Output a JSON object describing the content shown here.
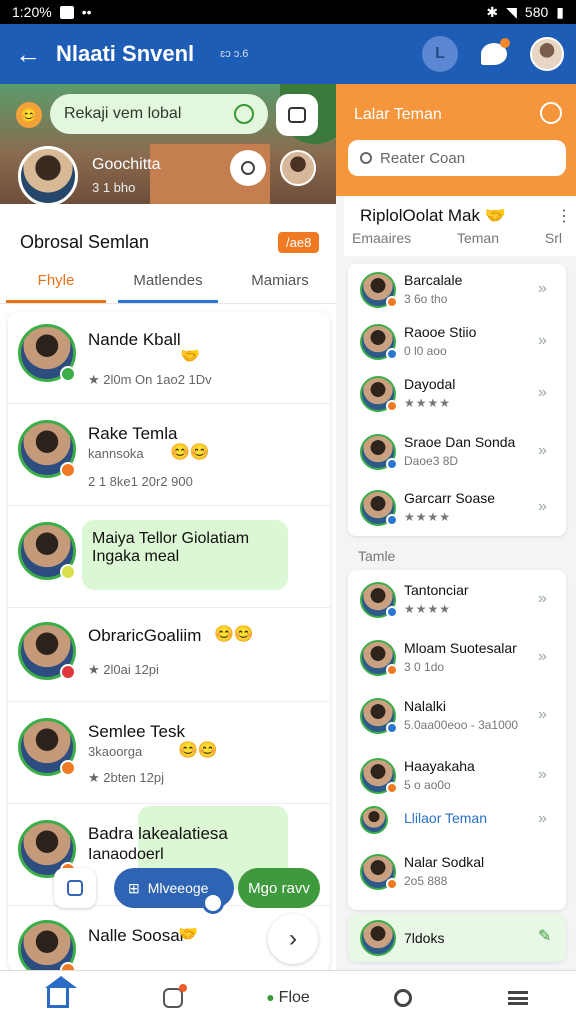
{
  "status_bar": {
    "time": "1:20%",
    "battery": "580"
  },
  "app_bar": {
    "title": "Nlaati Snvenl",
    "subtitle": "ɛɔ ɔ.6",
    "circle_label": "L"
  },
  "hero": {
    "search_text": "Rekaji vem lobal",
    "name": "Goochitta",
    "meta": "3 1 bho"
  },
  "left": {
    "section_title": "Obrosal Semlan",
    "badge": "/ae8",
    "tabs": [
      "Fhyle",
      "Matlendes",
      "Mamiars"
    ]
  },
  "conversations": [
    {
      "name": "Nande Kball",
      "meta": "★ 2l0m On 1ao2 1Dv"
    },
    {
      "name": "Rake Temla",
      "sub": "kannsoka",
      "meta": "2 1 8ke1 20r2 900"
    },
    {
      "bubble_line1": "Maiya Tellor Giolatiam",
      "bubble_line2": "Ingaka meal"
    },
    {
      "name": "ObraricGoaliim",
      "meta": "★ 2l0ai 12pi"
    },
    {
      "name": "Semlee Tesk",
      "sub": "3kaoorga",
      "meta": "★ 2bten 12pj"
    },
    {
      "bubble_line1": "Badra lakealatiesa",
      "bubble_line2": "Ianaodoerl"
    },
    {
      "name": "Nalle Soosal"
    }
  ],
  "floating": {
    "messages_label": "Mlveeoge",
    "new_label": "Mgo ravv"
  },
  "right": {
    "title": "Lalar Teman",
    "search_placeholder": "Reater Coan",
    "card_title": "RiplolOolat Mak",
    "tabs": [
      "Emaaires",
      "Teman",
      "Srl"
    ],
    "top_rows": [
      {
        "name": "Barcalale",
        "meta": "3 6o tho"
      },
      {
        "name": "Raooe Stiio",
        "meta": "0 l0 aoo"
      },
      {
        "name": "Dayodal",
        "meta": "★★★★"
      },
      {
        "name": "Sraoe Dan Sonda",
        "meta": "Daoe3 8D"
      },
      {
        "name": "Garcarr Soase",
        "meta": "★★★★"
      }
    ],
    "section_label": "Tamle",
    "bottom_rows": [
      {
        "name": "Tantonciar",
        "meta": "★★★★"
      },
      {
        "name": "Mloam Suotesalar",
        "meta": "3 0 1do"
      },
      {
        "name": "Nalalki",
        "meta": "5.0aa00eoo - 3a1000"
      },
      {
        "name": "Haayakaha",
        "meta": "5 o ao0o"
      },
      {
        "link": "Llilaor Teman"
      },
      {
        "name": "Nalar Sodkal",
        "meta": "2o5 888"
      },
      {
        "name": "7ldoks"
      }
    ]
  },
  "bottom_nav": {
    "center_label": "Floe"
  }
}
